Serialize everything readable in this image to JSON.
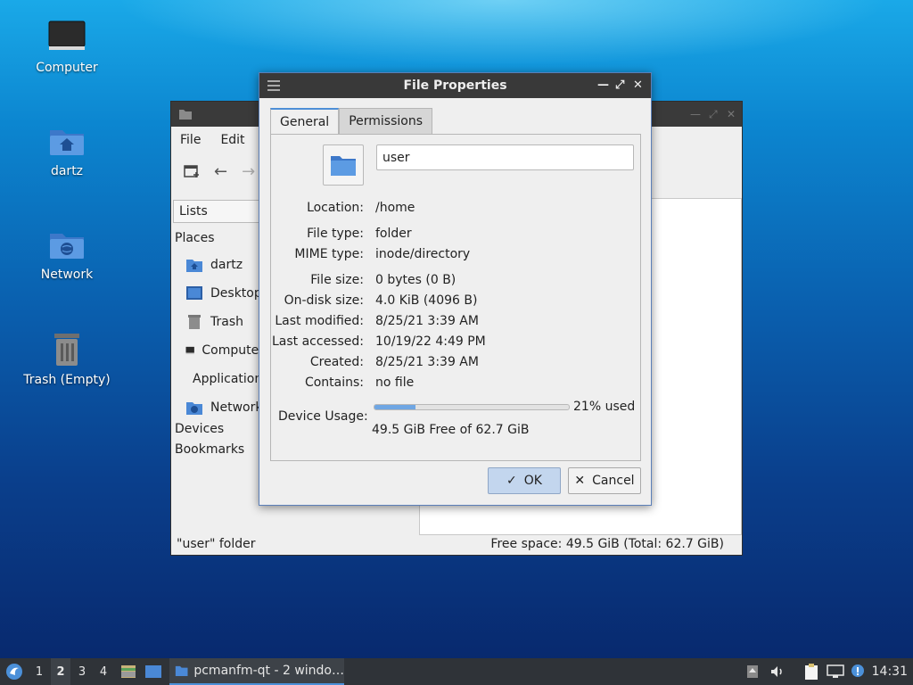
{
  "desktop": {
    "icons": [
      {
        "label": "Computer",
        "icon": "computer-icon"
      },
      {
        "label": "dartz",
        "icon": "home-folder-icon"
      },
      {
        "label": "Network",
        "icon": "network-folder-icon"
      },
      {
        "label": "Trash (Empty)",
        "icon": "trash-icon"
      }
    ]
  },
  "file_manager": {
    "menu": {
      "file": "File",
      "edit": "Edit"
    },
    "side_header": "Lists",
    "places_label": "Places",
    "places": [
      {
        "label": "dartz",
        "icon": "home-folder-icon"
      },
      {
        "label": "Desktop",
        "icon": "desktop-icon"
      },
      {
        "label": "Trash",
        "icon": "trash-icon"
      },
      {
        "label": "Computer",
        "icon": "computer-icon"
      },
      {
        "label": "Applications",
        "icon": "applications-icon"
      },
      {
        "label": "Network",
        "icon": "network-folder-icon"
      }
    ],
    "devices_label": "Devices",
    "bookmarks_label": "Bookmarks",
    "status_left": "\"user\" folder",
    "status_right": "Free space: 49.5 GiB (Total: 62.7 GiB)"
  },
  "dialog": {
    "title": "File Properties",
    "tabs": {
      "general": "General",
      "permissions": "Permissions"
    },
    "name_value": "user",
    "props": {
      "location": {
        "k": "Location:",
        "v": "/home"
      },
      "file_type": {
        "k": "File type:",
        "v": "folder"
      },
      "mime_type": {
        "k": "MIME type:",
        "v": "inode/directory"
      },
      "file_size": {
        "k": "File size:",
        "v": "0 bytes (0 B)"
      },
      "on_disk": {
        "k": "On-disk size:",
        "v": "4.0 KiB (4096 B)"
      },
      "modified": {
        "k": "Last modified:",
        "v": "8/25/21 3:39 AM"
      },
      "accessed": {
        "k": "Last accessed:",
        "v": "10/19/22 4:49 PM"
      },
      "created": {
        "k": "Created:",
        "v": "8/25/21 3:39 AM"
      },
      "contains": {
        "k": "Contains:",
        "v": "no file"
      }
    },
    "usage": {
      "label": "Device Usage:",
      "percent_text": "21% used",
      "fraction": 0.21,
      "free_text": "49.5 GiB Free of 62.7 GiB"
    },
    "buttons": {
      "ok": "OK",
      "cancel": "Cancel"
    }
  },
  "taskbar": {
    "workspaces": [
      "1",
      "2",
      "3",
      "4"
    ],
    "current_workspace": "2",
    "task_label": "pcmanfm-qt - 2 windo…",
    "clock": "14:31"
  },
  "colors": {
    "accent": "#4b90d9",
    "dialog_border": "#5b7fb8",
    "titlebar": "#393939",
    "taskbar": "#2f3338"
  }
}
